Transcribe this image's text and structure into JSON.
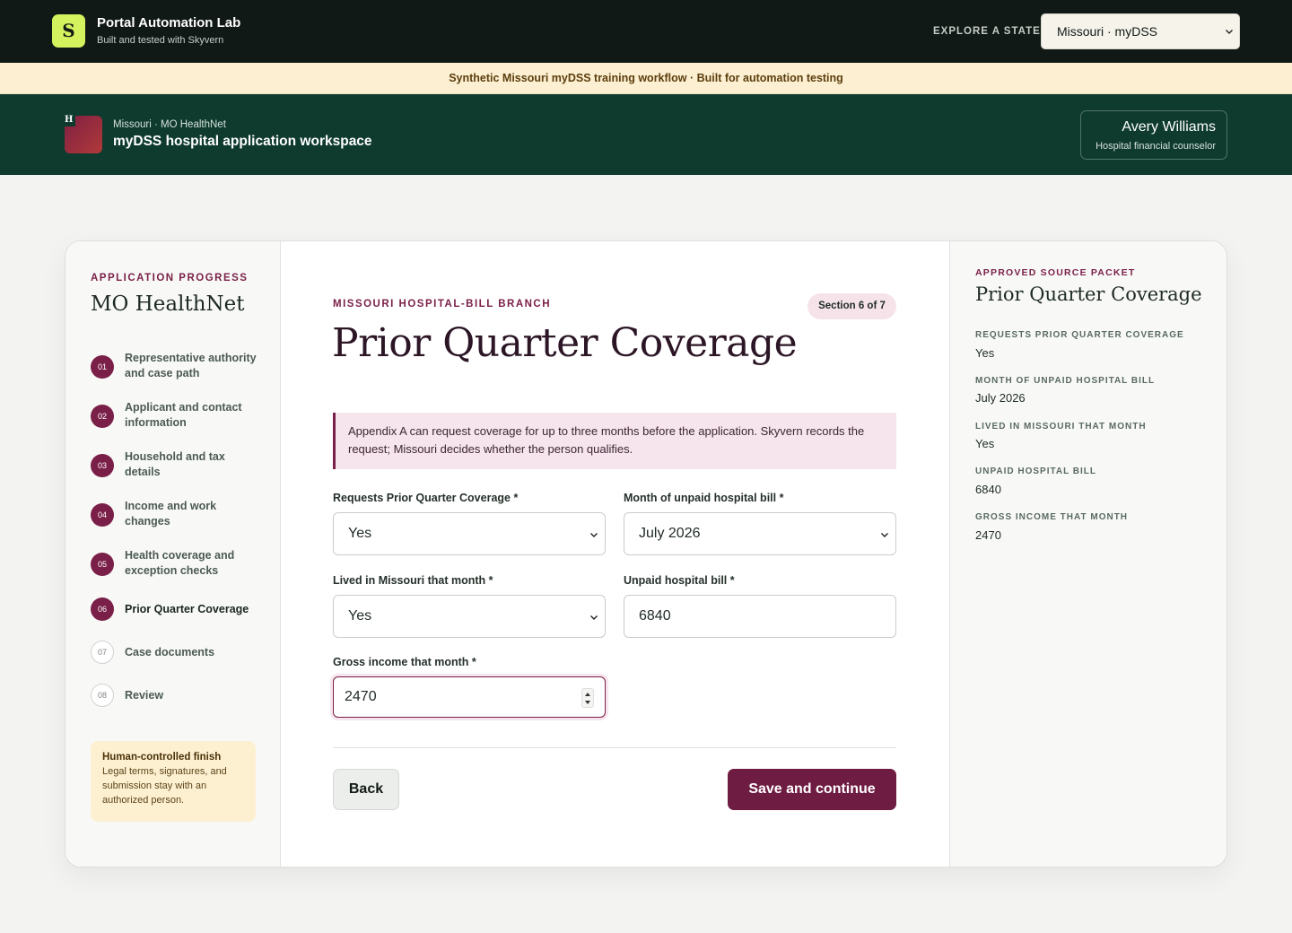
{
  "app": {
    "logo_letter": "S",
    "name": "Portal Automation Lab",
    "subtitle": "Built and tested with Skyvern",
    "explore_label": "EXPLORE A STATE",
    "state_selected": "Missouri · myDSS"
  },
  "banner": {
    "text": "Synthetic Missouri myDSS training workflow · Built for automation testing"
  },
  "portal": {
    "logo_letter": "H",
    "breadcrumb": "Missouri · MO HealthNet",
    "title": "myDSS hospital application workspace",
    "user_name": "Avery Williams",
    "user_role": "Hospital financial counselor"
  },
  "sidebar": {
    "label": "APPLICATION PROGRESS",
    "title": "MO HealthNet",
    "steps": [
      {
        "num": "01",
        "label": "Representative authority and case path",
        "status": "done"
      },
      {
        "num": "02",
        "label": "Applicant and contact information",
        "status": "done"
      },
      {
        "num": "03",
        "label": "Household and tax details",
        "status": "done"
      },
      {
        "num": "04",
        "label": "Income and work changes",
        "status": "done"
      },
      {
        "num": "05",
        "label": "Health coverage and exception checks",
        "status": "done"
      },
      {
        "num": "06",
        "label": "Prior Quarter Coverage",
        "status": "current"
      },
      {
        "num": "07",
        "label": "Case documents",
        "status": "todo"
      },
      {
        "num": "08",
        "label": "Review",
        "status": "todo"
      }
    ],
    "note": {
      "heading": "Human-controlled finish",
      "body": "Legal terms, signatures, and submission stay with an authorized person."
    }
  },
  "main": {
    "eyebrow": "MISSOURI HOSPITAL-BILL BRANCH",
    "section_badge": "Section 6 of 7",
    "title": "Prior Quarter Coverage",
    "callout": "Appendix A can request coverage for up to three months before the application. Skyvern records the request; Missouri decides whether the person qualifies.",
    "fields": {
      "requests_pqc": {
        "label": "Requests Prior Quarter Coverage *",
        "value": "Yes"
      },
      "unpaid_month": {
        "label": "Month of unpaid hospital bill *",
        "value": "July 2026"
      },
      "lived_in_mo": {
        "label": "Lived in Missouri that month *",
        "value": "Yes"
      },
      "unpaid_bill": {
        "label": "Unpaid hospital bill *",
        "value": "6840"
      },
      "gross_income": {
        "label": "Gross income that month *",
        "value": "2470"
      }
    },
    "back_label": "Back",
    "save_label": "Save and continue"
  },
  "packet": {
    "label": "APPROVED SOURCE PACKET",
    "title": "Prior Quarter Coverage",
    "items": [
      {
        "key": "REQUESTS PRIOR QUARTER COVERAGE",
        "value": "Yes"
      },
      {
        "key": "MONTH OF UNPAID HOSPITAL BILL",
        "value": "July 2026"
      },
      {
        "key": "LIVED IN MISSOURI THAT MONTH",
        "value": "Yes"
      },
      {
        "key": "UNPAID HOSPITAL BILL",
        "value": "6840"
      },
      {
        "key": "GROSS INCOME THAT MONTH",
        "value": "2470"
      }
    ]
  },
  "colors": {
    "topbar": "#111916",
    "brand_accent": "#d4f25d",
    "portal_header": "#0f3b2f",
    "primary": "#6f1c42",
    "banner": "#fcefd2"
  }
}
